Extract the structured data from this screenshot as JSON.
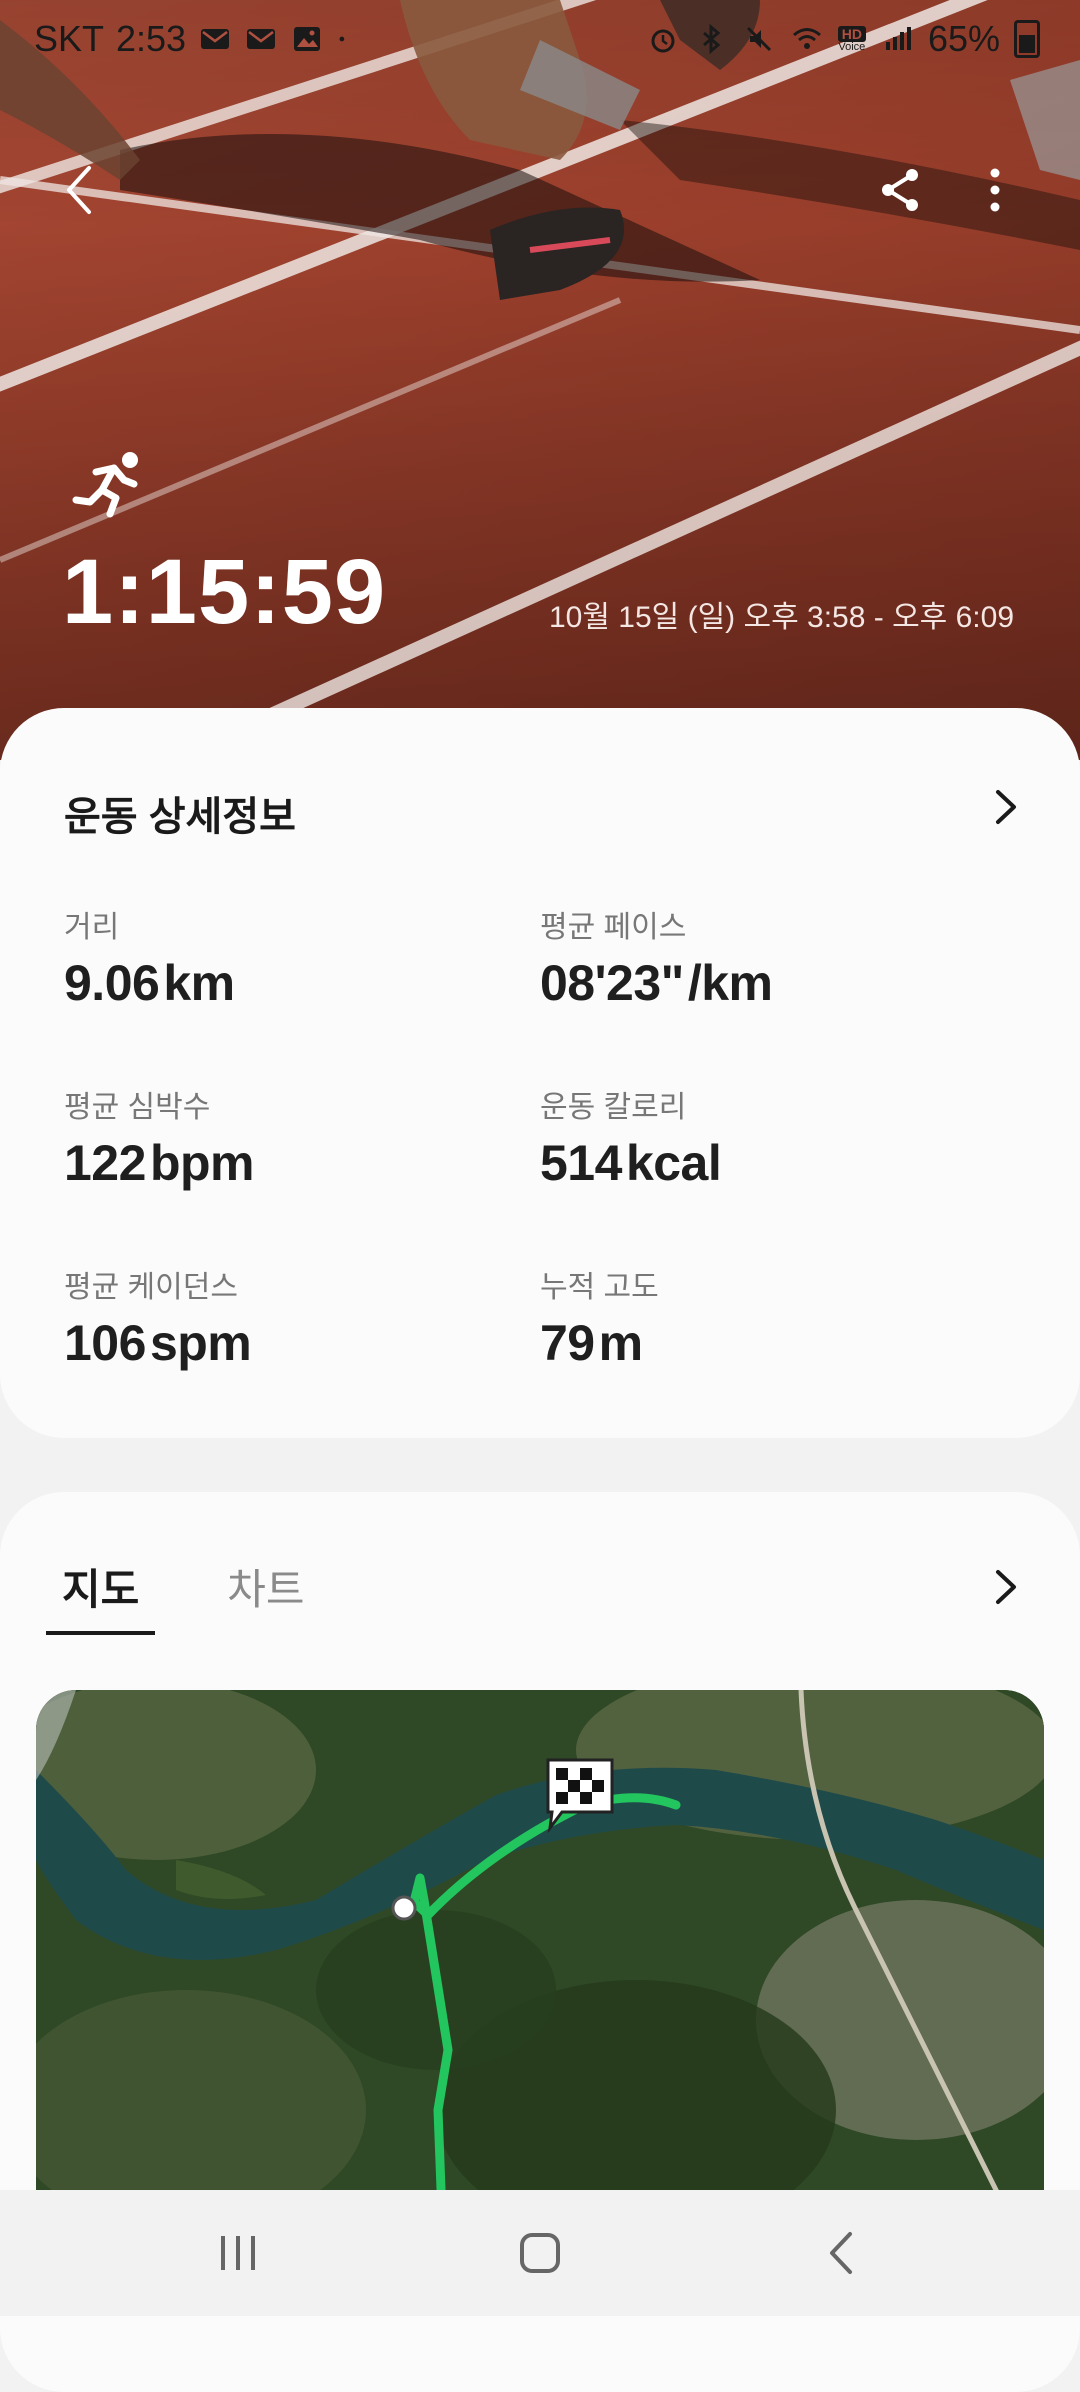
{
  "status_bar": {
    "carrier": "SKT",
    "time": "2:53",
    "battery": "65%",
    "hd_badge": "HD",
    "voice_label": "Voice",
    "icons_left": [
      "mail-icon",
      "mail-icon",
      "image-icon",
      "dot-icon"
    ],
    "icons_right": [
      "alarm-icon",
      "bluetooth-icon",
      "mute-icon",
      "wifi-icon",
      "hd-voice-icon",
      "signal-icon",
      "battery-icon"
    ]
  },
  "header": {
    "back_icon": "chevron-left-icon",
    "share_icon": "share-icon",
    "more_icon": "more-vertical-icon"
  },
  "workout": {
    "activity_icon": "running-icon",
    "duration": "1:15:59",
    "date_range": "10월 15일 (일) 오후 3:58 - 오후 6:09"
  },
  "details": {
    "title": "운동 상세정보",
    "metrics": [
      {
        "label": "거리",
        "value": "9.06",
        "unit": "km"
      },
      {
        "label": "평균 페이스",
        "value": "08'23\"",
        "unit": "/km"
      },
      {
        "label": "평균 심박수",
        "value": "122",
        "unit": "bpm"
      },
      {
        "label": "운동 칼로리",
        "value": "514",
        "unit": "kcal"
      },
      {
        "label": "평균 케이던스",
        "value": "106",
        "unit": "spm"
      },
      {
        "label": "누적 고도",
        "value": "79",
        "unit": "m"
      }
    ]
  },
  "map_section": {
    "tabs": [
      {
        "label": "지도",
        "active": true
      },
      {
        "label": "차트",
        "active": false
      }
    ],
    "route_color": "#22c55e",
    "finish_icon": "checkered-flag-icon",
    "start_icon": "start-dot-icon"
  },
  "colors": {
    "track": "#9b3f2c",
    "card": "#fbfbfb",
    "text_primary": "#1a1a1a",
    "text_secondary": "#777777"
  },
  "nav_bar": {
    "recent_icon": "recent-apps-icon",
    "home_icon": "home-icon",
    "back_icon": "back-icon"
  }
}
